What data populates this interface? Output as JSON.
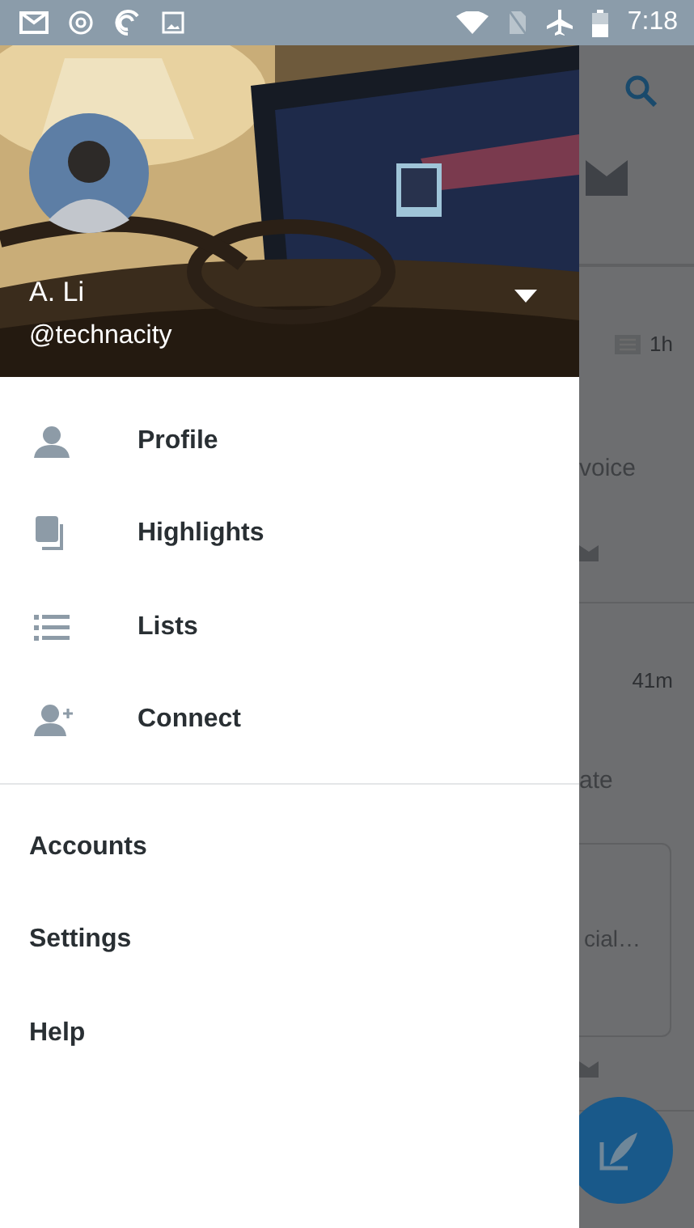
{
  "status_bar": {
    "time": "7:18"
  },
  "drawer": {
    "name": "A. Li",
    "handle": "@technacity",
    "primary_items": [
      {
        "label": "Profile"
      },
      {
        "label": "Highlights"
      },
      {
        "label": "Lists"
      },
      {
        "label": "Connect"
      }
    ],
    "secondary_items": [
      {
        "label": "Accounts"
      },
      {
        "label": "Settings"
      },
      {
        "label": "Help"
      }
    ]
  },
  "background_feed": [
    {
      "time": "1h",
      "text": "voice"
    },
    {
      "time": "41m",
      "text": "ate",
      "card_text": "cial…"
    }
  ]
}
